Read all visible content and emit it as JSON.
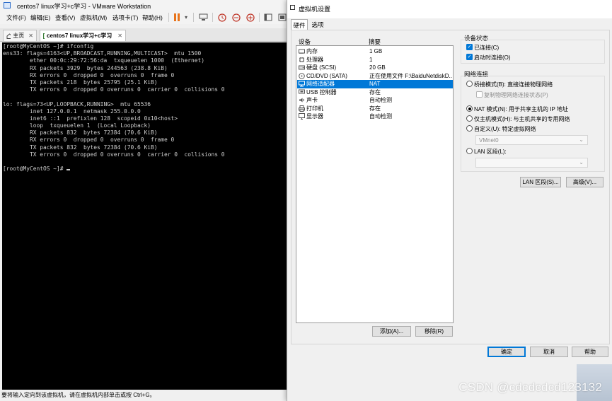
{
  "vmware": {
    "title": "centos7 linux学习+c学习 - VMware Workstation",
    "menu": [
      "文件(F)",
      "编辑(E)",
      "查看(V)",
      "虚拟机(M)",
      "选项卡(T)",
      "帮助(H)"
    ],
    "tabs": [
      {
        "label": "主页"
      },
      {
        "label": "centos7 linux学习+c学习"
      }
    ],
    "terminal_lines": [
      "[root@MyCentOS ~]# ifconfig",
      "ens33: flags=4163<UP,BROADCAST,RUNNING,MULTICAST>  mtu 1500",
      "        ether 00:0c:29:72:56:da  txqueuelen 1000  (Ethernet)",
      "        RX packets 3929  bytes 244563 (238.8 KiB)",
      "        RX errors 0  dropped 0  overruns 0  frame 0",
      "        TX packets 218  bytes 25795 (25.1 KiB)",
      "        TX errors 0  dropped 0 overruns 0  carrier 0  collisions 0",
      "",
      "lo: flags=73<UP,LOOPBACK,RUNNING>  mtu 65536",
      "        inet 127.0.0.1  netmask 255.0.0.0",
      "        inet6 ::1  prefixlen 128  scopeid 0x10<host>",
      "        loop  txqueuelen 1  (Local Loopback)",
      "        RX packets 832  bytes 72384 (70.6 KiB)",
      "        RX errors 0  dropped 0  overruns 0  frame 0",
      "        TX packets 832  bytes 72384 (70.6 KiB)",
      "        TX errors 0  dropped 0 overruns 0  carrier 0  collisions 0",
      "",
      "[root@MyCentOS ~]# "
    ],
    "status": "要将输入定向到该虚拟机，请在虚拟机内部单击或按 Ctrl+G。"
  },
  "dialog": {
    "title": "虚拟机设置",
    "tabs": [
      "硬件",
      "选项"
    ],
    "device_header": "设备",
    "summary_header": "摘要",
    "devices": [
      {
        "name": "内存",
        "summary": "1 GB",
        "icon": "memory-icon",
        "selected": false
      },
      {
        "name": "处理器",
        "summary": "1",
        "icon": "cpu-icon",
        "selected": false
      },
      {
        "name": "硬盘 (SCSI)",
        "summary": "20 GB",
        "icon": "harddisk-icon",
        "selected": false
      },
      {
        "name": "CD/DVD (SATA)",
        "summary": "正在使用文件 F:\\BaiduNetdiskD...",
        "icon": "cdrom-icon",
        "selected": false
      },
      {
        "name": "网络适配器",
        "summary": "NAT",
        "icon": "network-icon",
        "selected": true
      },
      {
        "name": "USB 控制器",
        "summary": "存在",
        "icon": "usb-icon",
        "selected": false
      },
      {
        "name": "声卡",
        "summary": "自动检测",
        "icon": "sound-icon",
        "selected": false
      },
      {
        "name": "打印机",
        "summary": "存在",
        "icon": "printer-icon",
        "selected": false
      },
      {
        "name": "显示器",
        "summary": "自动检测",
        "icon": "display-icon",
        "selected": false
      }
    ],
    "add_button": "添加(A)...",
    "remove_button": "移除(R)",
    "device_status": {
      "title": "设备状态",
      "connected": {
        "label": "已连接(C)",
        "checked": true
      },
      "connect_on_power": {
        "label": "启动时连接(O)",
        "checked": true
      }
    },
    "network": {
      "title": "网络连接",
      "bridged": {
        "label": "桥接模式(B): 直接连接物理网络",
        "selected": false
      },
      "replicate": {
        "label": "复制物理网络连接状态(P)",
        "checked": false
      },
      "nat": {
        "label": "NAT 模式(N): 用于共享主机的 IP 地址",
        "selected": true
      },
      "hostonly": {
        "label": "仅主机模式(H): 与主机共享的专用网络",
        "selected": false
      },
      "custom": {
        "label": "自定义(U): 特定虚拟网络",
        "selected": false
      },
      "custom_value": "VMnet0",
      "lan": {
        "label": "LAN 区段(L):",
        "selected": false
      },
      "lan_value": ""
    },
    "lan_segments_button": "LAN 区段(S)...",
    "advanced_button": "高级(V)...",
    "ok_button": "确定",
    "cancel_button": "取消",
    "help_button": "帮助"
  },
  "watermark": "CSDN @cdcdcdcd123132",
  "colors": {
    "selection": "#0078d7",
    "terminal_bg": "#000000",
    "terminal_fg": "#cfcfcf",
    "pause_icon": "#e8731a"
  }
}
